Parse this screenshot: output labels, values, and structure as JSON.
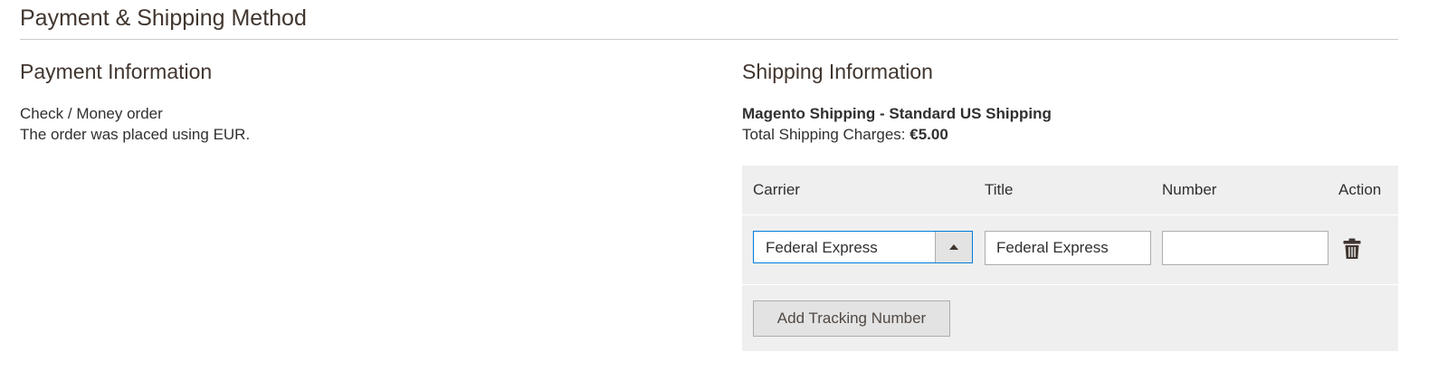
{
  "section": {
    "title": "Payment & Shipping Method"
  },
  "payment": {
    "title": "Payment Information",
    "method": "Check / Money order",
    "currency_note": "The order was placed using EUR."
  },
  "shipping": {
    "title": "Shipping Information",
    "method": "Magento Shipping - Standard US Shipping",
    "charges_label": "Total Shipping Charges:",
    "charges_value": "€5.00"
  },
  "tracking": {
    "columns": {
      "carrier": "Carrier",
      "title": "Title",
      "number": "Number",
      "action": "Action"
    },
    "rows": [
      {
        "carrier": "Federal Express",
        "title": "Federal Express",
        "number": ""
      }
    ],
    "add_button_label": "Add Tracking Number"
  },
  "colors": {
    "focus_border": "#007bdb",
    "panel_bg": "#efefef",
    "button_bg": "#e3e3e3"
  },
  "icons": {
    "select_toggle": "caret-up-icon",
    "delete": "trash-icon"
  }
}
